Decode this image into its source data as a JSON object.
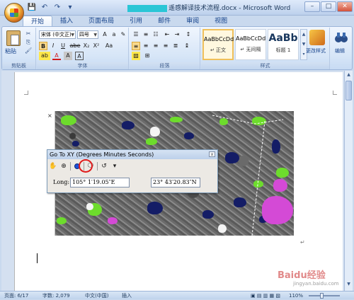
{
  "window": {
    "title_suffix": "遥感解译技术流程.docx - Microsoft Word",
    "min_label": "–",
    "max_label": "□",
    "close_label": "✕"
  },
  "quick_access": [
    "save-icon",
    "undo-icon",
    "redo-icon",
    "customize-icon"
  ],
  "tabs": [
    "开始",
    "插入",
    "页面布局",
    "引用",
    "邮件",
    "审阅",
    "视图"
  ],
  "ribbon": {
    "clipboard": {
      "paste_label": "粘贴",
      "group_label": "剪贴板"
    },
    "font": {
      "font_name": "宋体 (中文正)",
      "font_size": "四号",
      "bold": "B",
      "italic": "I",
      "underline": "U",
      "strike": "abe",
      "subscript": "X₂",
      "superscript": "X²",
      "clear": "Aa",
      "highlight": "ab",
      "color": "A",
      "char_border": "A",
      "phonetic": "A",
      "group_label": "字体"
    },
    "paragraph": {
      "group_label": "段落"
    },
    "styles": {
      "items": [
        {
          "sample": "AaBbCcDd",
          "name": "↵ 正文"
        },
        {
          "sample": "AaBbCcDd",
          "name": "↵ 无间隔"
        },
        {
          "sample": "AaBb",
          "name": "标题 1"
        }
      ],
      "change_label": "更改样式",
      "group_label": "样式"
    },
    "editing": {
      "label": "编辑"
    }
  },
  "dialog": {
    "title": "Go To XY   (Degrees Minutes Seconds)",
    "close": "x",
    "long_label": "Long:",
    "long_value": "105° 1′19.05″E",
    "lat_value": "23° 43′20.83″N"
  },
  "status": {
    "page": "页面: 6/17",
    "words": "字数: 2,079",
    "lang": "中文(中国)",
    "mode": "插入",
    "zoom": "110%"
  },
  "watermark": {
    "text": "Baidu经验",
    "sub": "jingyan.baidu.com"
  }
}
